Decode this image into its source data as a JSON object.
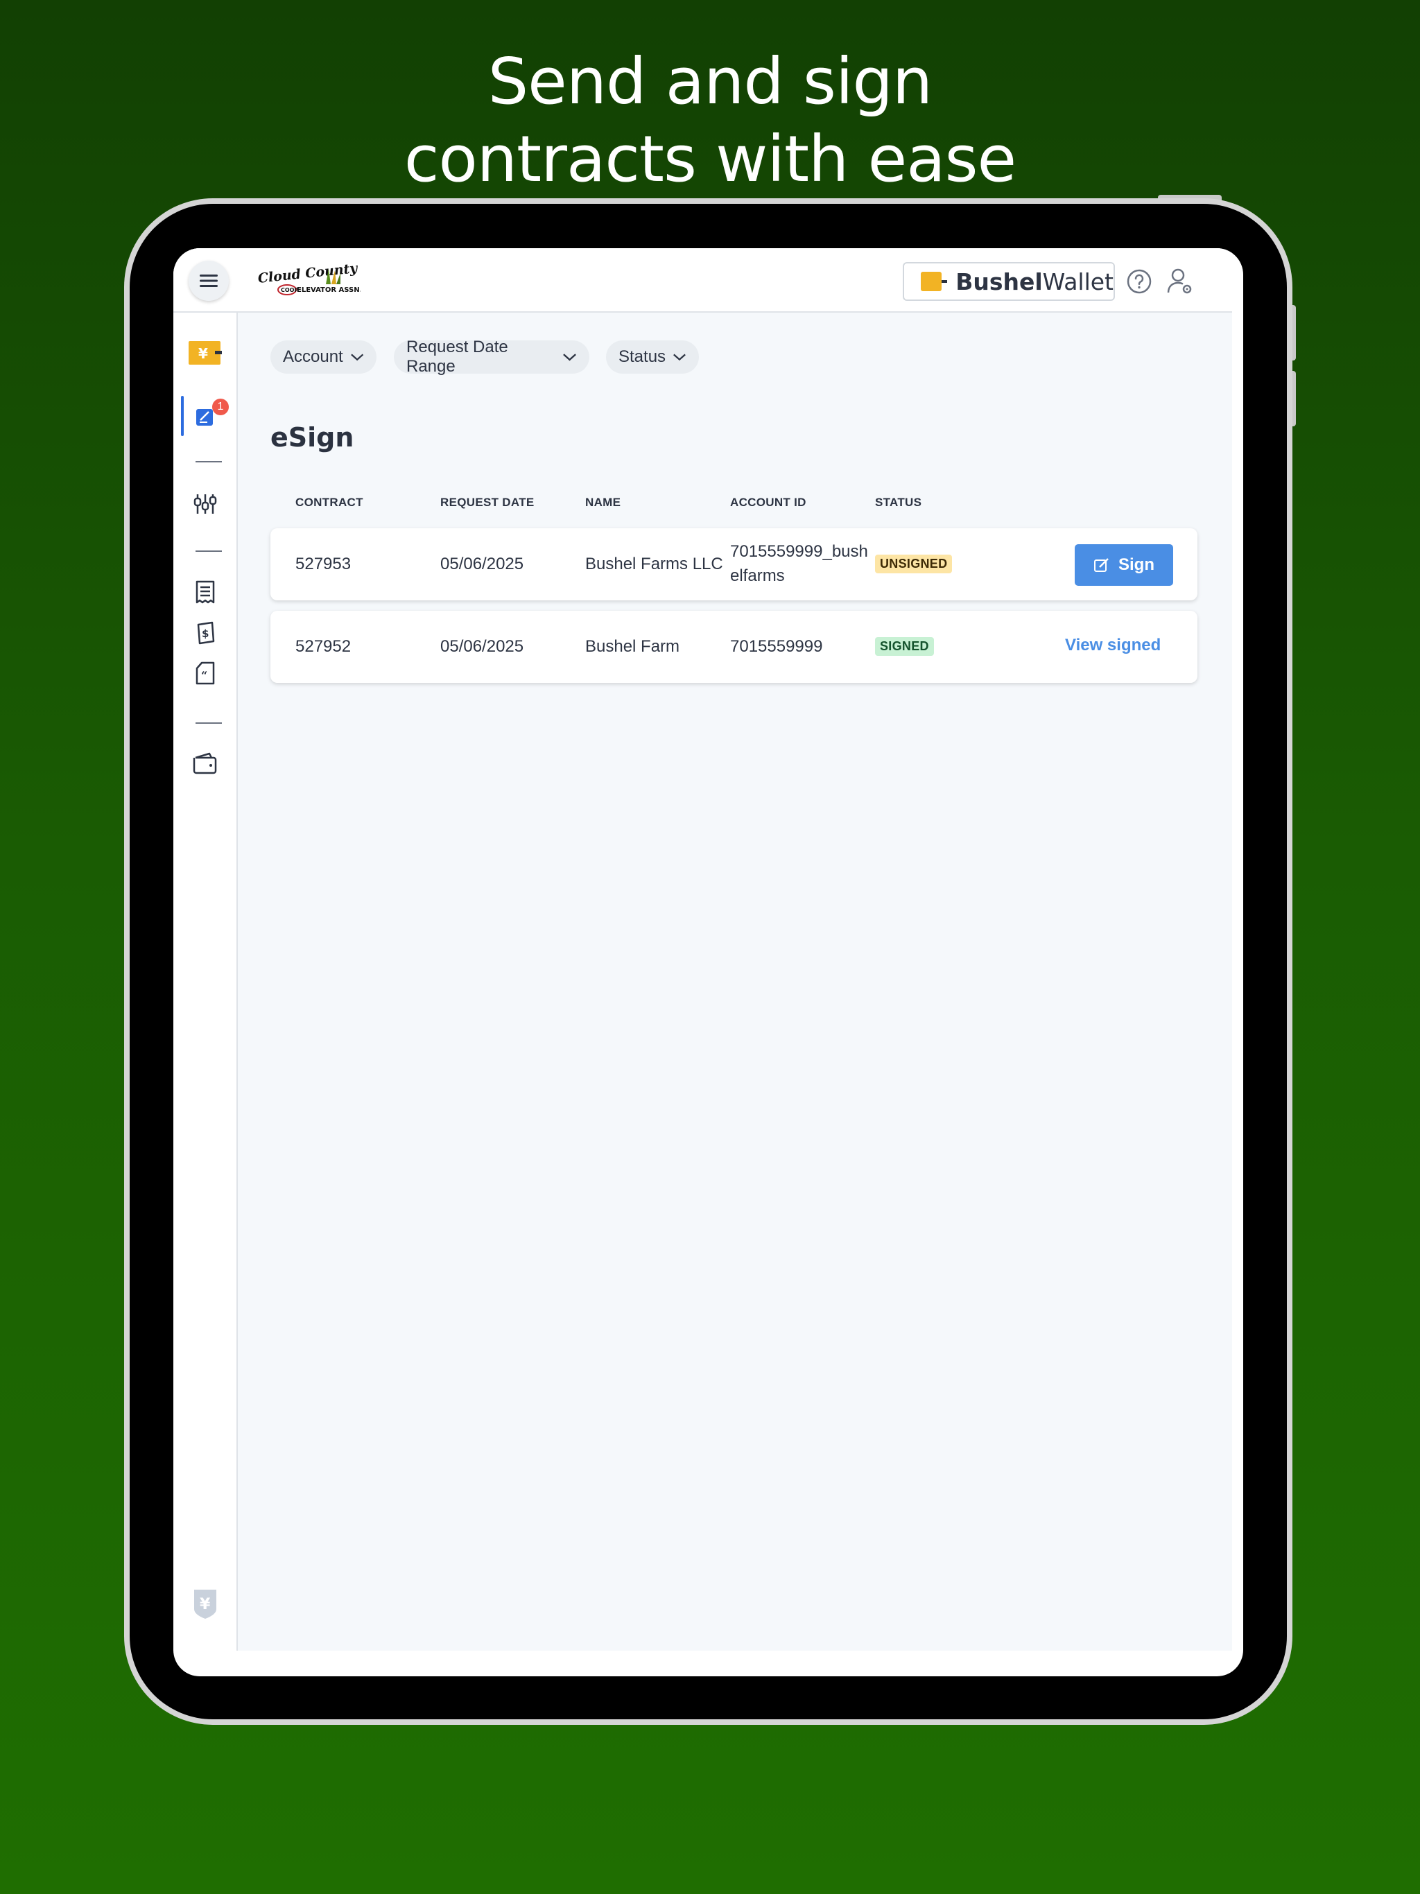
{
  "headline": {
    "line1": "Send and sign",
    "line2": "contracts with ease"
  },
  "header": {
    "logo": {
      "line1": "Cloud County",
      "line2": "ELEVATOR ASSN.",
      "badge": "COOP"
    },
    "wallet": {
      "brand": "Bushel",
      "product": "Wallet"
    },
    "icons": [
      "menu-icon",
      "help-icon",
      "user-settings-icon"
    ]
  },
  "sidebar": {
    "notification_count": "1",
    "icons": [
      "bushel-wallet-icon",
      "esign-icon",
      "adjustments-icon",
      "receipt-icon",
      "payment-icon",
      "quote-document-icon",
      "wallet-icon",
      "bushel-shield-icon"
    ]
  },
  "filters": [
    {
      "label": "Account"
    },
    {
      "label": "Request Date Range"
    },
    {
      "label": "Status"
    }
  ],
  "page": {
    "title": "eSign"
  },
  "table": {
    "columns": [
      "CONTRACT",
      "REQUEST DATE",
      "NAME",
      "ACCOUNT ID",
      "STATUS"
    ],
    "rows": [
      {
        "contract": "527953",
        "request_date": "05/06/2025",
        "name": "Bushel Farms LLC",
        "account_id_line1": "7015559999_bush",
        "account_id_line2": "elfarms",
        "status": "UNSIGNED",
        "action": "Sign"
      },
      {
        "contract": "527952",
        "request_date": "05/06/2025",
        "name": "Bushel Farm",
        "account_id_line1": "7015559999",
        "status": "SIGNED",
        "action": "View signed"
      }
    ]
  },
  "colors": {
    "accent": "#4a8ee4",
    "brand_yellow": "#f2b324",
    "unsigned_bg": "#fde5a5",
    "signed_bg": "#c8f1d4",
    "background_green": "#1a5c03"
  }
}
